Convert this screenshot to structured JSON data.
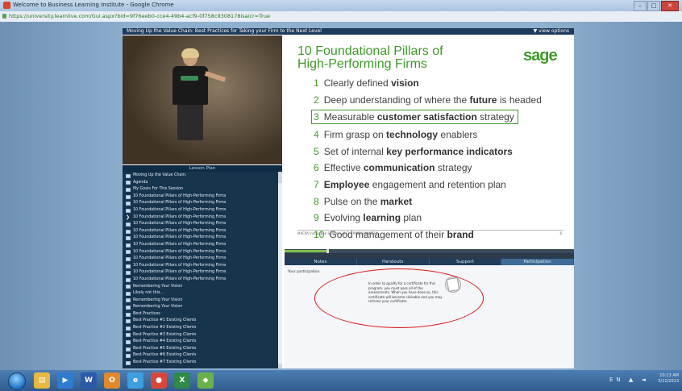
{
  "window": {
    "title": "Welcome to Business Learning Institute - Google Chrome",
    "url": "https://university.learnlive.com/Gui.aspx?bid=9f76eeb0-cce4-49b4-acf9-0f758c9308178isaicr=True"
  },
  "player": {
    "title": "Moving Up the Value Chain: Best Practices for Taking your Firm to the Next Level",
    "view_options": "▼ view options"
  },
  "lesson_plan": {
    "heading": "Lesson Plan",
    "items": [
      {
        "label": "Moving Up the Value Chain.",
        "icon": "page-icon"
      },
      {
        "label": "Agenda",
        "icon": "page-icon"
      },
      {
        "label": "My Goals For This Session",
        "icon": "page-icon"
      },
      {
        "label": "10 Foundational Pillars of High-Performing Firms",
        "icon": "page-icon"
      },
      {
        "label": "10 Foundational Pillars of High-Performing Firms",
        "icon": "page-icon"
      },
      {
        "label": "10 Foundational Pillars of High-Performing Firms",
        "icon": "page-icon"
      },
      {
        "label": "10 Foundational Pillars of High-Performing Firms",
        "icon": "current-arrow-icon"
      },
      {
        "label": "10 Foundational Pillars of High-Performing Firms",
        "icon": "page-icon"
      },
      {
        "label": "10 Foundational Pillars of High-Performing Firms",
        "icon": "page-icon"
      },
      {
        "label": "10 Foundational Pillars of High-Performing Firms",
        "icon": "page-icon"
      },
      {
        "label": "10 Foundational Pillars of High-Performing Firms",
        "icon": "page-icon"
      },
      {
        "label": "10 Foundational Pillars of High-Performing Firms",
        "icon": "page-icon"
      },
      {
        "label": "10 Foundational Pillars of High-Performing Firms",
        "icon": "page-icon"
      },
      {
        "label": "10 Foundational Pillars of High-Performing Firms",
        "icon": "page-icon"
      },
      {
        "label": "10 Foundational Pillars of High-Performing Firms",
        "icon": "page-icon"
      },
      {
        "label": "10 Foundational Pillars of High-Performing Firms",
        "icon": "page-icon"
      },
      {
        "label": "Remembering Your Vision",
        "icon": "page-icon"
      },
      {
        "label": "Likely not this...",
        "icon": "page-icon"
      },
      {
        "label": "Remembering Your Vision",
        "icon": "page-icon"
      },
      {
        "label": "Remembering Your Vision",
        "icon": "page-icon"
      },
      {
        "label": "Best Practices",
        "icon": "page-icon"
      },
      {
        "label": "Best Practice #1 Existing Clients",
        "icon": "page-icon"
      },
      {
        "label": "Best Practice #2 Existing Clients",
        "icon": "page-icon"
      },
      {
        "label": "Best Practice #3 Existing Clients",
        "icon": "page-icon"
      },
      {
        "label": "Best Practice #4 Existing Clients",
        "icon": "page-icon"
      },
      {
        "label": "Best Practice #5 Existing Clients",
        "icon": "page-icon"
      },
      {
        "label": "Best Practice #6 Existing Clients",
        "icon": "page-icon"
      },
      {
        "label": "Best Practice #7 Existing Clients",
        "icon": "page-icon"
      }
    ]
  },
  "slide": {
    "title_line1": "10 Foundational Pillars of",
    "title_line2": "High-Performing Firms",
    "logo": "sage",
    "accent": "#3f9a2a",
    "pillars": [
      {
        "n": "1",
        "pre": "Clearly defined ",
        "bold": "vision",
        "post": ""
      },
      {
        "n": "2",
        "pre": "Deep understanding of where the ",
        "bold": "future",
        "post": " is headed"
      },
      {
        "n": "3",
        "pre": "Measurable ",
        "bold": "customer satisfaction",
        "post": " strategy"
      },
      {
        "n": "4",
        "pre": "Firm grasp on ",
        "bold": "technology",
        "post": " enablers"
      },
      {
        "n": "5",
        "pre": "Set of internal ",
        "bold": "key performance indicators",
        "post": ""
      },
      {
        "n": "6",
        "pre": "Effective ",
        "bold": "communication",
        "post": " strategy"
      },
      {
        "n": "7",
        "pre": "",
        "bold": "Employee",
        "post": " engagement and retention plan"
      },
      {
        "n": "8",
        "pre": "Pulse on the ",
        "bold": "market",
        "post": ""
      },
      {
        "n": "9",
        "pre": "Evolving ",
        "bold": "learning",
        "post": " plan"
      },
      {
        "n": "10",
        "pre": "Good management of their ",
        "bold": "brand",
        "post": ""
      }
    ],
    "highlighted_index": 2,
    "footer": "MACPA Innovation Summit 2013 · #MDSUMMIT13",
    "page": "6"
  },
  "progress": {
    "fraction": 0.145
  },
  "tabs": [
    {
      "label": "Notes",
      "active": false
    },
    {
      "label": "Handouts",
      "active": false
    },
    {
      "label": "Support",
      "active": false
    },
    {
      "label": "Participation",
      "active": true
    }
  ],
  "participation": {
    "label": "Your participation",
    "message": "In order to qualify for a certificate for this program, you must pass all of the assessments. When you have done so, this certificate will become clickable and you may retrieve your certificate."
  },
  "taskbar": {
    "apps": [
      {
        "name": "explorer-icon",
        "glyph": "▤",
        "color": "#e8b842"
      },
      {
        "name": "media-icon",
        "glyph": "▶",
        "color": "#2f7bd0"
      },
      {
        "name": "word-icon",
        "glyph": "W",
        "color": "#2a5aa8"
      },
      {
        "name": "outlook-icon",
        "glyph": "O",
        "color": "#e0882a"
      },
      {
        "name": "ie-icon",
        "glyph": "e",
        "color": "#3d9ee0"
      },
      {
        "name": "chrome-icon",
        "glyph": "●",
        "color": "#d9473a"
      },
      {
        "name": "excel-icon",
        "glyph": "X",
        "color": "#2e8a46"
      },
      {
        "name": "app-icon",
        "glyph": "◆",
        "color": "#6bb04a"
      }
    ],
    "lang": "EN",
    "time": "10:13 AM",
    "date": "5/11/2013"
  }
}
